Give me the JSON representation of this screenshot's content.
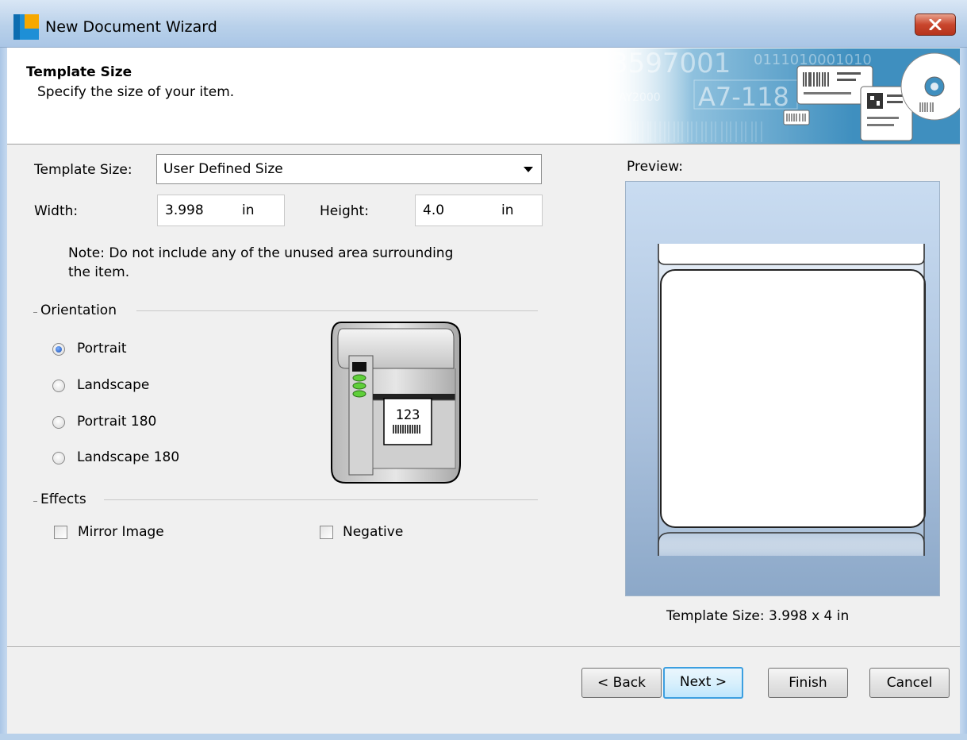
{
  "window": {
    "title": "New Document Wizard",
    "close_icon": "close-icon"
  },
  "header": {
    "title": "Template Size",
    "subtitle": "Specify the size of your item.",
    "banner_texts": {
      "number": "3597001",
      "code": "A7-118",
      "year": "AY2000",
      "binary": "0111010001010"
    }
  },
  "form": {
    "template_size_label": "Template Size:",
    "template_size_value": "User Defined Size",
    "width_label": "Width:",
    "width_value": "3.998",
    "width_unit": "in",
    "height_label": "Height:",
    "height_value": "4.0",
    "height_unit": "in",
    "note_line1": "Note: Do not include any of the unused area surrounding",
    "note_line2": "the item."
  },
  "orientation": {
    "group_label": "Orientation",
    "options": [
      {
        "label": "Portrait",
        "checked": true
      },
      {
        "label": "Landscape",
        "checked": false
      },
      {
        "label": "Portrait 180",
        "checked": false
      },
      {
        "label": "Landscape 180",
        "checked": false
      }
    ],
    "printer_label_text": "123"
  },
  "effects": {
    "group_label": "Effects",
    "mirror_label": "Mirror Image",
    "mirror_checked": false,
    "negative_label": "Negative",
    "negative_checked": false
  },
  "preview": {
    "label": "Preview:",
    "size_text": "Template Size:  3.998 x 4 in"
  },
  "buttons": {
    "back": "< Back",
    "next": "Next >",
    "finish": "Finish",
    "cancel": "Cancel"
  },
  "colors": {
    "accent": "#3c9fe0",
    "close": "#c9462d",
    "banner": "#3f8fbf"
  }
}
